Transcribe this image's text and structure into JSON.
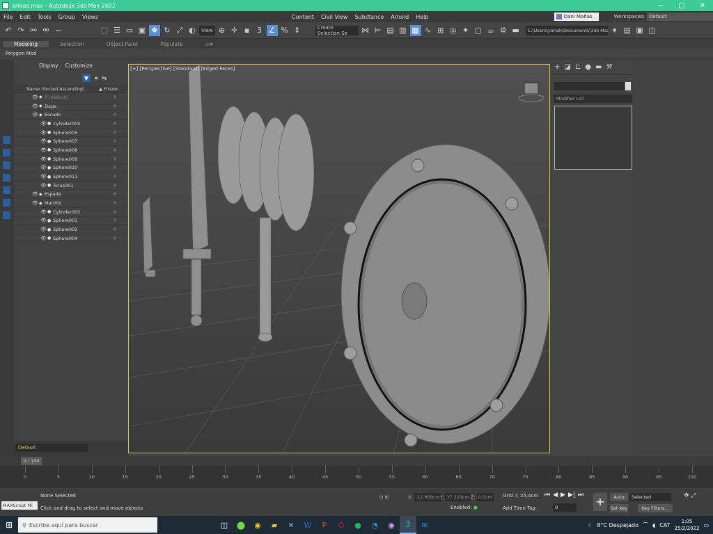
{
  "window": {
    "title": "armas.max - Autodesk 3ds Max 2022",
    "controls": [
      "−",
      "▢",
      "✕"
    ]
  },
  "menu": {
    "items": [
      "File",
      "Edit",
      "Tools",
      "Group",
      "Views",
      "Content",
      "Civil View",
      "Substance",
      "Arnold",
      "Help"
    ],
    "user": "Dani Mañas",
    "workspaces_label": "Workspaces:",
    "workspace": "Default"
  },
  "toolbar": {
    "view_dropdown": "View",
    "selection_set": "Create Selection Se",
    "project_path": "C:\\Users\\yahah\\Documents\\3ds Max 2022"
  },
  "ribbon": {
    "tabs": [
      "Modeling",
      "Selection",
      "Object Paint",
      "Populate"
    ],
    "active_tab": "Modeling",
    "sub_label": "Polygon Mod"
  },
  "explorer": {
    "tabs": [
      "Display",
      "Customize"
    ],
    "col_name": "Name (Sorted Ascending)",
    "col_frozen": "▲ Frozen",
    "rows": [
      {
        "name": "0 (default)",
        "type": "layer",
        "dim": true
      },
      {
        "name": "Daga",
        "type": "layer",
        "dim": false
      },
      {
        "name": "Escudo",
        "type": "layer",
        "dim": false
      },
      {
        "name": "Cylinder005",
        "type": "object",
        "dim": false
      },
      {
        "name": "Sphere005",
        "type": "object",
        "dim": false
      },
      {
        "name": "Sphere007",
        "type": "object",
        "dim": false
      },
      {
        "name": "Sphere008",
        "type": "object",
        "dim": false
      },
      {
        "name": "Sphere009",
        "type": "object",
        "dim": false
      },
      {
        "name": "Sphere010",
        "type": "object",
        "dim": false
      },
      {
        "name": "Sphere011",
        "type": "object",
        "dim": false
      },
      {
        "name": "Torus001",
        "type": "object",
        "dim": false
      },
      {
        "name": "Espada",
        "type": "layer",
        "dim": false
      },
      {
        "name": "Martillo",
        "type": "layer",
        "dim": false
      },
      {
        "name": "Cylinder002",
        "type": "object",
        "dim": false
      },
      {
        "name": "Sphere001",
        "type": "object",
        "dim": false
      },
      {
        "name": "Sphere002",
        "type": "object",
        "dim": false
      },
      {
        "name": "Sphere004",
        "type": "object",
        "dim": false
      }
    ]
  },
  "viewport": {
    "label": "[+] [Perspective] [Standard] [Edged Faces]"
  },
  "command_panel": {
    "modifier_list": "Modifier List"
  },
  "layer": {
    "current": "Default"
  },
  "timeline": {
    "frame_readout": "0 / 100",
    "ticks": [
      "0",
      "5",
      "10",
      "15",
      "20",
      "25",
      "30",
      "35",
      "40",
      "45",
      "50",
      "55",
      "60",
      "65",
      "70",
      "75",
      "80",
      "85",
      "90",
      "95",
      "100"
    ]
  },
  "status": {
    "maxscript": "MAXScript Mi",
    "selection": "None Selected",
    "hint": "Click and drag to select and move objects",
    "x_label": "X:",
    "x_value": "-12.968cm",
    "y_label": "Y:",
    "y_value": "37.219cm",
    "z_label": "Z:",
    "z_value": "0.0cm",
    "grid": "Grid = 25,4cm",
    "enabled": "Enabled:",
    "add_time_tag": "Add Time Tag",
    "current_frame": "0",
    "auto_key": "Auto Key",
    "set_key": "Set Key",
    "key_selection": "Selected",
    "key_filters": "Key Filters..."
  },
  "taskbar": {
    "search_placeholder": "Escribe aquí para buscar",
    "weather": "8°C  Despejado",
    "lang": "CAT",
    "time": "1:05",
    "date": "25/2/2022"
  },
  "colors": {
    "title_bar": "#3bcc9a",
    "accent_selected": "#5b8fd1",
    "viewport_border": "#e3c24a"
  }
}
